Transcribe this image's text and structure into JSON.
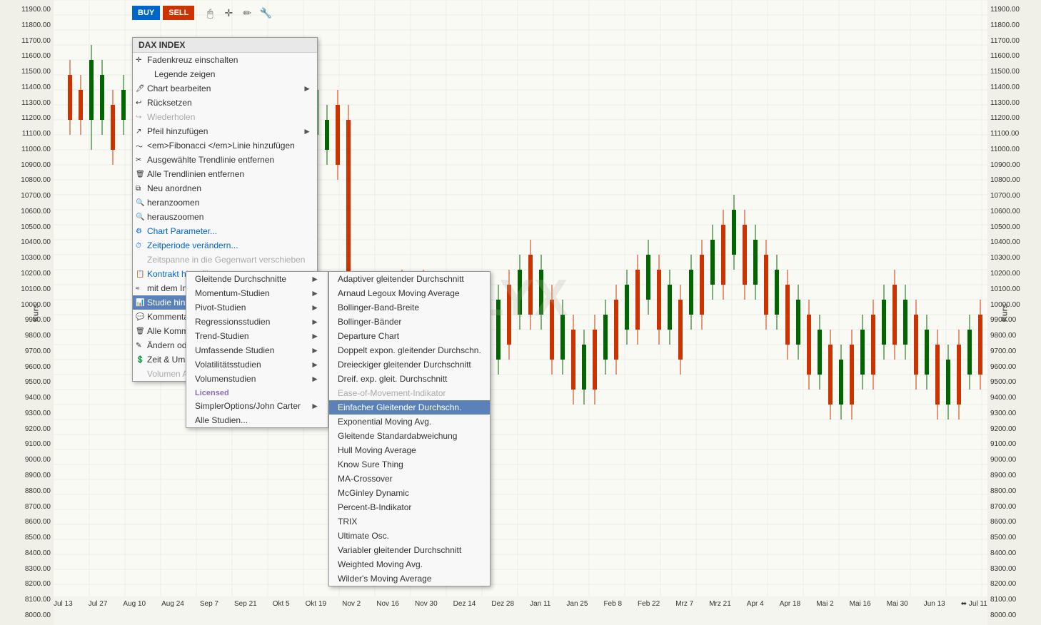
{
  "chart": {
    "title": "DAX INDEX",
    "watermark": "LYX",
    "kurs_label": "Kurs",
    "y_axis": {
      "values": [
        "11900.00",
        "11800.00",
        "11700.00",
        "11600.00",
        "11500.00",
        "11400.00",
        "11300.00",
        "11200.00",
        "11100.00",
        "11000.00",
        "10900.00",
        "10800.00",
        "10700.00",
        "10600.00",
        "10500.00",
        "10400.00",
        "10300.00",
        "10200.00",
        "10100.00",
        "10000.00",
        "9900.00",
        "9800.00",
        "9700.00",
        "9600.00",
        "9500.00",
        "9400.00",
        "9300.00",
        "9200.00",
        "9100.00",
        "9000.00",
        "8900.00",
        "8800.00",
        "8700.00",
        "8600.00",
        "8500.00",
        "8400.00",
        "8300.00",
        "8200.00",
        "8100.00",
        "8000.00"
      ]
    },
    "x_axis": {
      "values": [
        "Jul 13",
        "Jul 27",
        "Aug 10",
        "Aug 24",
        "Sep 7",
        "Sep 21",
        "Okt 5",
        "Okt 19",
        "Nov 2",
        "Nov 16",
        "Nov 30",
        "Dez 14",
        "Dez 28",
        "Jan 11",
        "Jan 25",
        "Feb 8",
        "Feb 22",
        "Mrz 7",
        "Mrz 21",
        "Apr 4",
        "Apr 18",
        "Mai 2",
        "Mai 16",
        "Mai 30",
        "Jun 13",
        "Jul 11"
      ]
    }
  },
  "toolbar": {
    "buy_label": "BUY",
    "sell_label": "SELL"
  },
  "context_menu": {
    "title": "DAX INDEX",
    "items": [
      {
        "id": "crosshair",
        "label": "Fadenkreuz einschalten",
        "icon": "+",
        "disabled": false
      },
      {
        "id": "legend",
        "label": "Legende zeigen",
        "disabled": false
      },
      {
        "id": "edit-chart",
        "label": "Chart bearbeiten",
        "has_submenu": true,
        "disabled": false
      },
      {
        "id": "reset",
        "label": "Rücksetzen",
        "disabled": false
      },
      {
        "id": "redo",
        "label": "Wiederholen",
        "disabled": true
      },
      {
        "id": "add-arrow",
        "label": "Pfeil hinzufügen",
        "has_submenu": true,
        "disabled": false
      },
      {
        "id": "add-fibonacci",
        "label": "<em>Fibonacci </em><em>Linie hinzufügen",
        "disabled": false
      },
      {
        "id": "remove-selected",
        "label": "Ausgewählte Trendlinie entfernen",
        "disabled": false
      },
      {
        "id": "remove-all",
        "label": "Alle Trendlinien entfernen",
        "disabled": false
      },
      {
        "id": "rearrange",
        "label": "Neu anordnen",
        "disabled": false
      },
      {
        "id": "zoom-in",
        "label": "heranzoomen",
        "disabled": false
      },
      {
        "id": "zoom-out",
        "label": "herauszoomen",
        "disabled": false
      },
      {
        "id": "chart-params",
        "label": "Chart Parameter...",
        "disabled": false,
        "is_link": true
      },
      {
        "id": "timeperiod",
        "label": "Zeitperiode verändern...",
        "disabled": false,
        "is_link": true
      },
      {
        "id": "shift-time",
        "label": "Zeitspanne in die Gegenwart verschieben",
        "disabled": true
      },
      {
        "id": "add-contract",
        "label": "Kontrakt hinzufügen...",
        "disabled": false,
        "is_link": true
      },
      {
        "id": "compare-index",
        "label": "mit dem Index vergleichen",
        "disabled": false
      },
      {
        "id": "add-study",
        "label": "Studie hinzufügen",
        "has_submenu": true,
        "highlighted": true
      },
      {
        "id": "add-comment",
        "label": "Kommentar hinzufügen",
        "disabled": false
      },
      {
        "id": "remove-comments",
        "label": "Alle Kommentare entfernen",
        "disabled": false
      },
      {
        "id": "change-remove",
        "label": "Ändern oder entfernen",
        "has_submenu": true,
        "disabled": false
      },
      {
        "id": "time-volume",
        "label": "Zeit & Umsätze",
        "disabled": false
      },
      {
        "id": "show-hide-volume",
        "label": "Volumen Anzeigen/Ausblenden",
        "disabled": true
      }
    ]
  },
  "submenu_l2": {
    "items": [
      {
        "id": "gleit-avg",
        "label": "Gleitende Durchschnitte",
        "has_submenu": true,
        "highlighted": false
      },
      {
        "id": "momentum",
        "label": "Momentum-Studien",
        "has_submenu": true
      },
      {
        "id": "pivot",
        "label": "Pivot-Studien",
        "has_submenu": true
      },
      {
        "id": "regression",
        "label": "Regressionsstudien",
        "has_submenu": true
      },
      {
        "id": "trend",
        "label": "Trend-Studien",
        "has_submenu": true
      },
      {
        "id": "umfassende",
        "label": "Umfassende Studien",
        "has_submenu": true
      },
      {
        "id": "volatility",
        "label": "Volatilitätsstudien",
        "has_submenu": true
      },
      {
        "id": "volume",
        "label": "Volumenstudien",
        "has_submenu": true
      },
      {
        "id": "licensed-label",
        "label": "Licensed",
        "is_section": true
      },
      {
        "id": "simpler-options",
        "label": "SimplerOptions/John Carter",
        "has_submenu": true
      },
      {
        "id": "all-studies",
        "label": "Alle Studien..."
      }
    ]
  },
  "submenu_l3": {
    "items": [
      {
        "id": "adaptive",
        "label": "Adaptiver gleitender Durchschnitt"
      },
      {
        "id": "arnaud",
        "label": "Arnaud Legoux Moving Average"
      },
      {
        "id": "bollinger-width",
        "label": "Bollinger-Band-Breite"
      },
      {
        "id": "bollinger-bands",
        "label": "Bollinger-Bänder"
      },
      {
        "id": "departure",
        "label": "Departure Chart"
      },
      {
        "id": "dbl-exp",
        "label": "Doppelt expon. gleitender Durchschn."
      },
      {
        "id": "triangular",
        "label": "Dreieckiger gleitender Durchschnitt"
      },
      {
        "id": "triple-exp",
        "label": "Dreif. exp. gleit. Durchschnitt"
      },
      {
        "id": "ease-movement",
        "label": "Ease-of-Movement-Indikator",
        "disabled": true
      },
      {
        "id": "simple-ma",
        "label": "Einfacher Gleitender Durchschn.",
        "highlighted": true
      },
      {
        "id": "exp-ma",
        "label": "Exponential Moving Avg."
      },
      {
        "id": "std-dev",
        "label": "Gleitende Standardabweichung"
      },
      {
        "id": "hull",
        "label": "Hull Moving Average"
      },
      {
        "id": "know-sure",
        "label": "Know Sure Thing"
      },
      {
        "id": "ma-crossover",
        "label": "MA-Crossover"
      },
      {
        "id": "mcginley",
        "label": "McGinley Dynamic"
      },
      {
        "id": "percent-b",
        "label": "Percent-B-Indikator"
      },
      {
        "id": "trix",
        "label": "TRIX"
      },
      {
        "id": "ultimate",
        "label": "Ultimate Osc."
      },
      {
        "id": "variable",
        "label": "Variabler gleitender Durchschnitt"
      },
      {
        "id": "weighted",
        "label": "Weighted Moving Avg."
      },
      {
        "id": "wilders",
        "label": "Wilder's Moving Average"
      }
    ]
  }
}
